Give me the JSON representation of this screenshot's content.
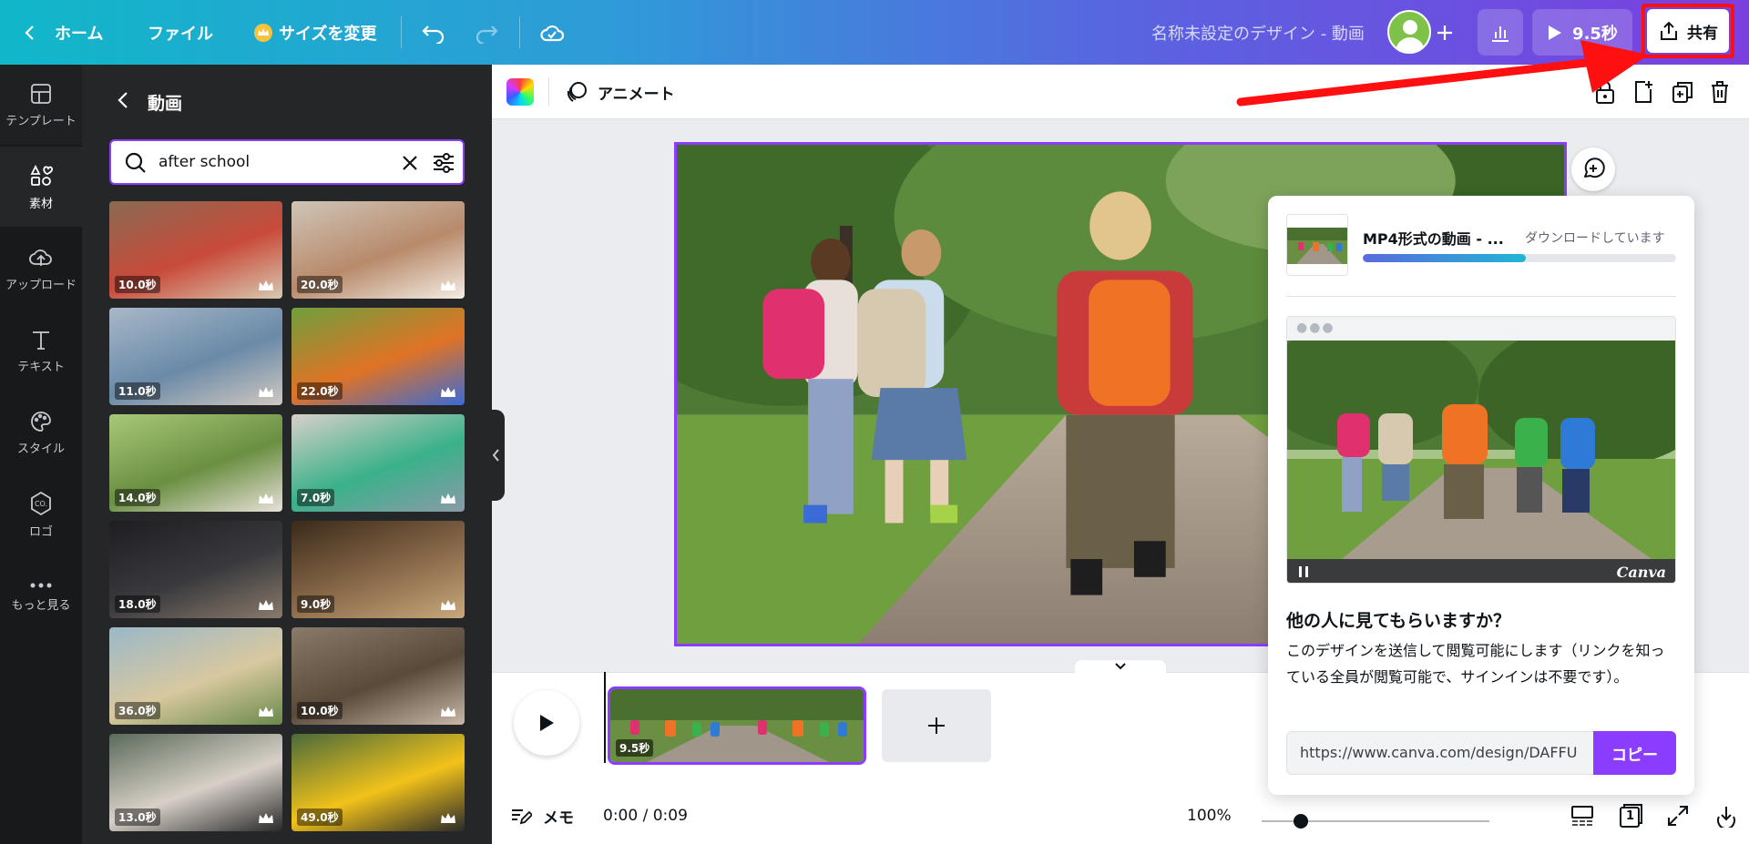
{
  "topbar": {
    "home_label": "ホーム",
    "file_label": "ファイル",
    "resize_label": "サイズを変更",
    "design_title": "名称未設定のデザイン - 動画",
    "play_duration": "9.5秒",
    "share_label": "共有"
  },
  "sidebar": {
    "items": [
      {
        "label": "テンプレート",
        "icon": "template-icon"
      },
      {
        "label": "素材",
        "icon": "elements-icon"
      },
      {
        "label": "アップロード",
        "icon": "upload-icon"
      },
      {
        "label": "テキスト",
        "icon": "text-icon"
      },
      {
        "label": "スタイル",
        "icon": "palette-icon"
      },
      {
        "label": "ロゴ",
        "icon": "logo-icon"
      },
      {
        "label": "もっと見る",
        "icon": "more-icon"
      }
    ]
  },
  "panel": {
    "title": "動画",
    "search_value": "after school",
    "videos": [
      {
        "duration": "10.0秒"
      },
      {
        "duration": "20.0秒"
      },
      {
        "duration": "11.0秒"
      },
      {
        "duration": "22.0秒"
      },
      {
        "duration": "14.0秒"
      },
      {
        "duration": "7.0秒"
      },
      {
        "duration": "18.0秒"
      },
      {
        "duration": "9.0秒"
      },
      {
        "duration": "36.0秒"
      },
      {
        "duration": "10.0秒"
      },
      {
        "duration": "13.0秒"
      },
      {
        "duration": "49.0秒"
      }
    ]
  },
  "toolbar": {
    "animate_label": "アニメート"
  },
  "timeline": {
    "clip_duration": "9.5秒"
  },
  "statusbar": {
    "notes_label": "メモ",
    "time": "0:00 / 0:09",
    "zoom": "100%",
    "page_count": "1"
  },
  "share_popup": {
    "download_title": "MP4形式の動画 - ...",
    "download_status": "ダウンロードしています",
    "download_progress": 0.52,
    "preview_logo": "Canva",
    "heading": "他の人に見てもらいますか？",
    "body": "このデザインを送信して閲覧可能にします（リンクを知っている全員が閲覧可能で、サインインは不要です）。",
    "link": "https://www.canva.com/design/DAFFU",
    "copy_label": "コピー"
  },
  "colors": {
    "accent": "#8b3dff",
    "annotation": "#ff1010"
  }
}
